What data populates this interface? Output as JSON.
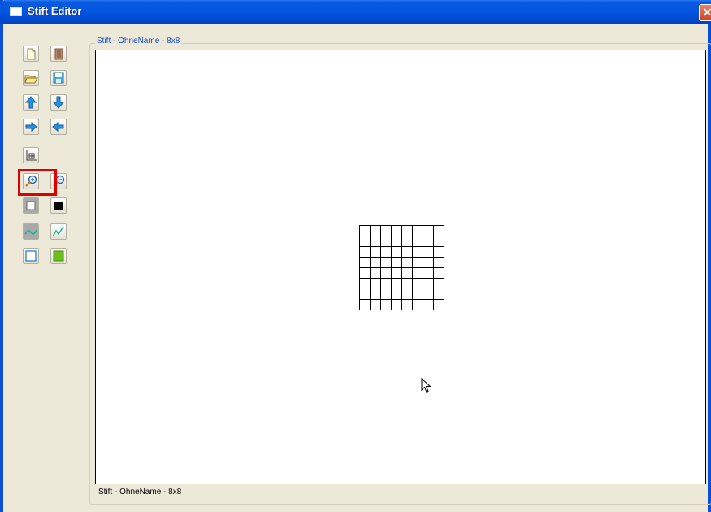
{
  "window": {
    "title": "Stift Editor",
    "close_glyph": "✕"
  },
  "toolbar": {
    "buttons": [
      {
        "name": "new-file",
        "icon": "new-page-icon"
      },
      {
        "name": "door",
        "icon": "door-icon"
      },
      {
        "name": "open-folder",
        "icon": "open-folder-icon"
      },
      {
        "name": "save",
        "icon": "floppy-disk-icon"
      },
      {
        "name": "move-up",
        "icon": "arrow-up-icon"
      },
      {
        "name": "move-down",
        "icon": "arrow-down-icon"
      },
      {
        "name": "move-right",
        "icon": "arrow-right-icon"
      },
      {
        "name": "move-left",
        "icon": "arrow-left-icon"
      },
      {
        "name": "resize-grid",
        "icon": "resize-grid-icon"
      },
      {
        "name": "zoom-in",
        "icon": "zoom-in-icon",
        "highlighted": true
      },
      {
        "name": "zoom-out",
        "icon": "zoom-out-icon"
      },
      {
        "name": "white-color",
        "icon": "white-square-icon"
      },
      {
        "name": "black-color",
        "icon": "black-square-icon"
      },
      {
        "name": "freehand-line",
        "icon": "curve-line-icon"
      },
      {
        "name": "polyline",
        "icon": "polyline-icon"
      },
      {
        "name": "rectangle-outline",
        "icon": "outline-rectangle-icon"
      },
      {
        "name": "rectangle-filled",
        "icon": "filled-rectangle-icon"
      }
    ],
    "highlight_color": "#e10000"
  },
  "editor": {
    "group_title": "Stift - OhneName - 8x8",
    "grid_rows": 8,
    "grid_cols": 8
  },
  "statusbar": {
    "text": "Stift - OhneName - 8x8"
  },
  "colors": {
    "titlebar": "#0255e0",
    "window_bg": "#ece9d8",
    "legend_text": "#1e4fc8",
    "close_button": "#d2431e"
  }
}
